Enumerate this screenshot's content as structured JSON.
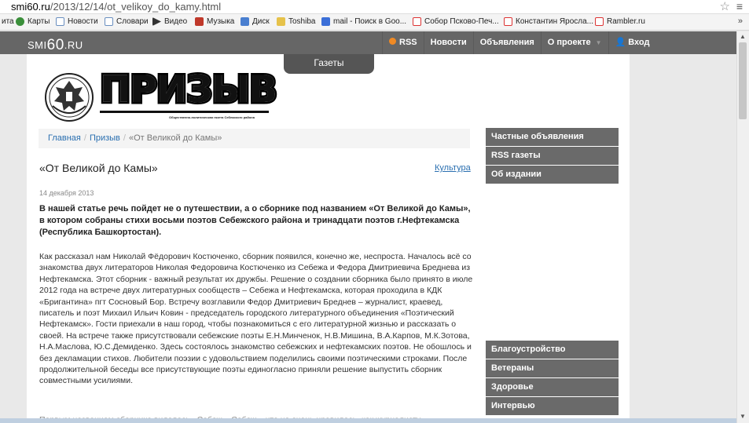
{
  "browser": {
    "url_host": "smi60.ru",
    "url_path": "/2013/12/14/ot_velikoy_do_kamy.html",
    "bookmarks": [
      {
        "label": "Карты",
        "icon": "maps-icon"
      },
      {
        "label": "Новости",
        "icon": "page-icon"
      },
      {
        "label": "Словари",
        "icon": "page-icon"
      },
      {
        "label": "Видео",
        "icon": "video-icon"
      },
      {
        "label": "Музыка",
        "icon": "music-icon"
      },
      {
        "label": "Диск",
        "icon": "disk-icon"
      },
      {
        "label": "Toshiba",
        "icon": "folder-icon"
      },
      {
        "label": "mail - Поиск в Goo...",
        "icon": "google-icon"
      },
      {
        "label": "Собор Псково-Печ...",
        "icon": "yandex-icon"
      },
      {
        "label": "Константин Яросла...",
        "icon": "yandex-icon"
      },
      {
        "label": "Rambler.ru",
        "icon": "yandex-icon"
      }
    ],
    "bookmarks_lead": "ита",
    "more": "»"
  },
  "site": {
    "logo_prefix": "SMI",
    "logo_number": "60",
    "logo_suffix": ".RU",
    "nav": {
      "rss": "RSS",
      "news": "Новости",
      "ads": "Объявления",
      "about": "О проекте",
      "login": "Вход"
    },
    "gazeti_tab": "Газеты"
  },
  "masthead": {
    "title": "ПРИЗЫВ",
    "subtitle": "Общественно-политическая газета Себежского района"
  },
  "breadcrumb": {
    "home": "Главная",
    "paper": "Призыв",
    "current": "«От Великой до Камы»"
  },
  "article": {
    "title": "«От Великой до Камы»",
    "category": "Культура",
    "date": "14 декабря 2013",
    "lead": "В нашей статье речь пойдет не о путешествии, а о сборнике под названием «От Великой до Камы», в котором собраны стихи восьми поэтов Себежского района и тринадцати поэтов г.Нефтекамска (Республика Башкортостан).",
    "body": "Как рассказал нам Николай Фёдорович Костюченко, сборник появился, конечно же, неспроста. Началось всё со знакомства двух литераторов Николая Федоровича Костюченко из Себежа и Федора Дмитриевича Бреднева из Нефтекамска. Этот сборник - важный результат их дружбы. Решение о создании сборника было принято в июле 2012 года на встрече двух литературных сообществ – Себежа и Нефтекамска, которая проходила в КДК «Бригантина» пгт Сосновый Бор. Встречу возглавили Федор Дмитриевич Бреднев – журналист, краевед, писатель и поэт Михаил Ильич Ковин -  председатель городского литературного объединения «Поэтический Нефтекамск». Гости приехали в наш город, чтобы познакомиться с его литературной жизнью и рассказать о своей. На встрече также присутствовали себежские поэты Е.Н.Минченок, Н.В.Мишина, В.А.Карпов, М.К.Зотова,          Н.А.Маслова, Ю.С.Демиденко. Здесь состоялось знакомство себежских и нефтекамских поэтов. Не обошлось и без декламации стихов. Любители поэзии с удовольствием поделились своими поэтическими строками. После продолжительной беседы все присутствующие поэты единогласно приняли решение выпустить сборник совместными усилиями.",
    "body_next": "Первым названием сборника виделось «Себеж – Себеж», что не очень нравилось, как журналисту"
  },
  "sidebar_top": [
    "Частные объявления",
    "RSS газеты",
    "Об издании"
  ],
  "sidebar_bottom": [
    "Благоустройство",
    "Ветераны",
    "Здоровье",
    "Интервью"
  ]
}
